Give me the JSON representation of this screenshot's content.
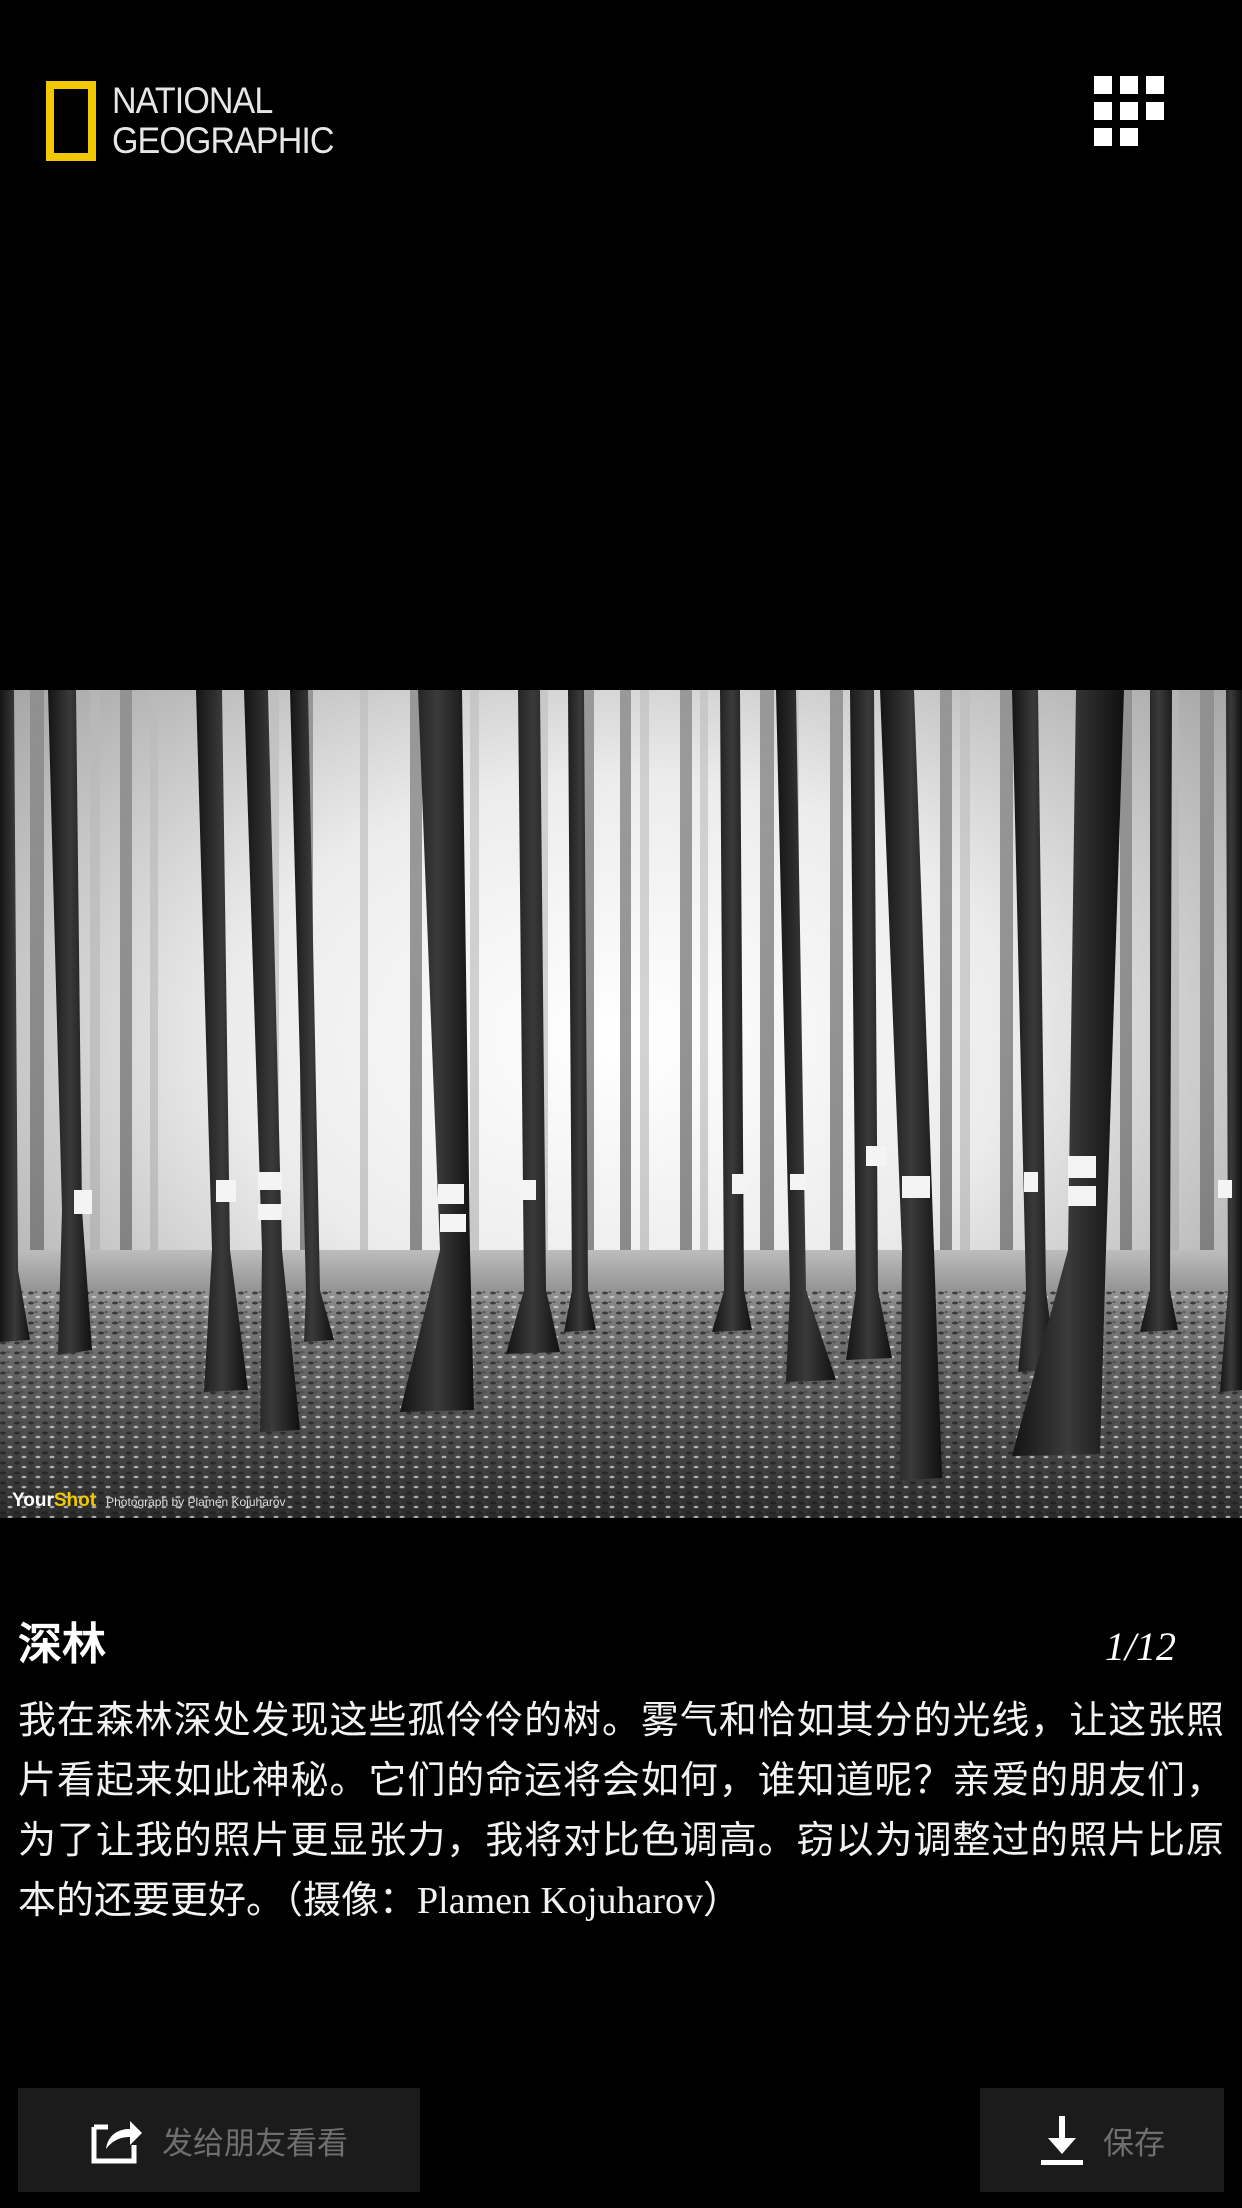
{
  "header": {
    "brand_line1": "NATIONAL",
    "brand_line2": "GEOGRAPHIC",
    "brand_color": "#f2c800",
    "menu_icon": "grid-menu-icon"
  },
  "photo": {
    "description_icon": "forest-photo",
    "credit_your": "Your",
    "credit_shot": "Shot",
    "credit_text": "Photograph by Plamen Kojuharov"
  },
  "caption": {
    "title": "深林",
    "counter": "1/12",
    "body_main": "我在森林深处发现这些孤伶伶的树。雾气和恰如其分的光线，让这张照片看起来如此神秘。它们的命运将会如何，谁知道呢？亲爱的朋友们，为了让我的照片更显张力，我将对比色调高。窃以为调整过的照片比原本的还要更好。（摄像：",
    "body_latin": "Plamen Kojuharov",
    "body_end": "）"
  },
  "actions": {
    "share_label": "发给朋友看看",
    "share_icon": "share-icon",
    "save_label": "保存",
    "save_icon": "download-icon"
  }
}
